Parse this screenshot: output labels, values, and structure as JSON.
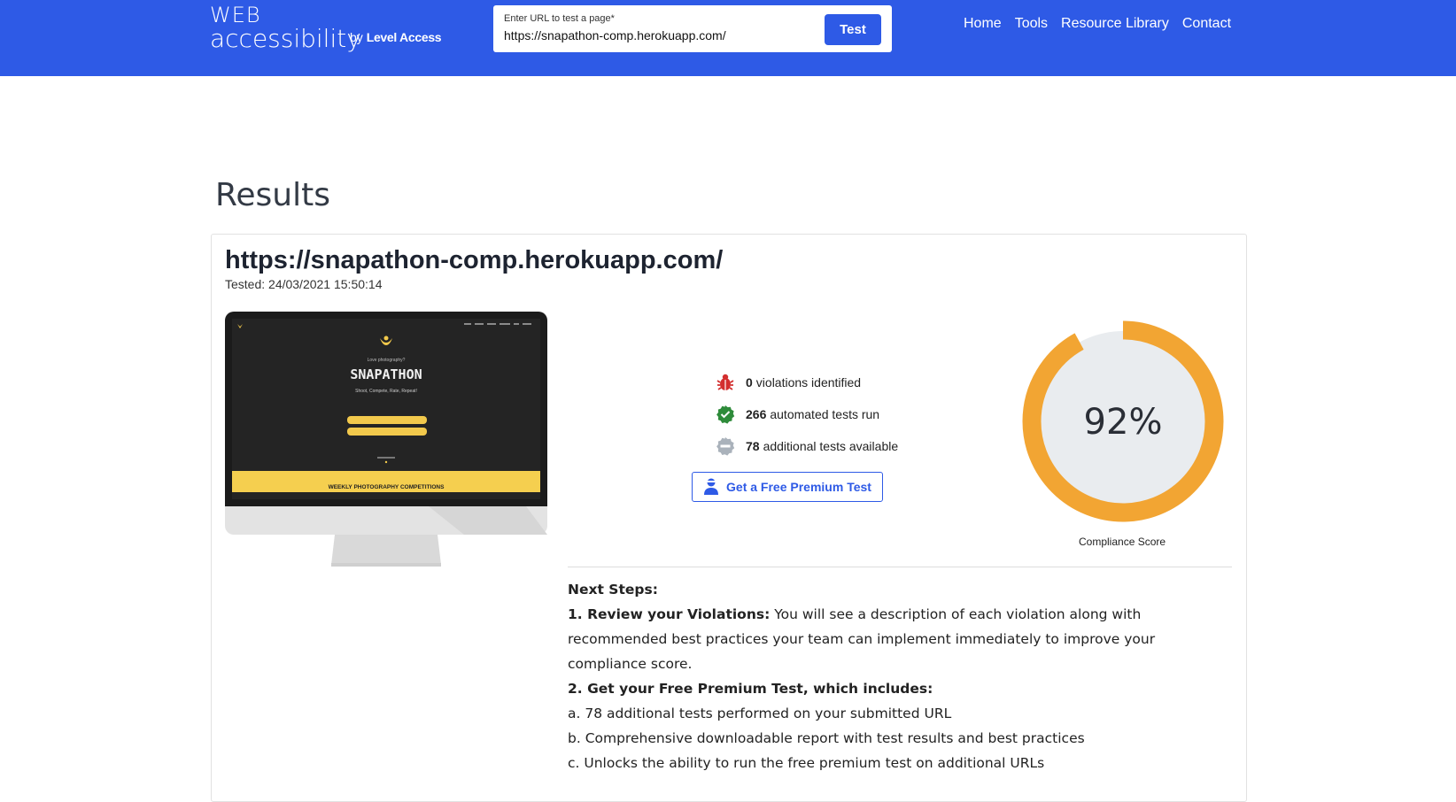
{
  "header": {
    "logo_top": "WEB",
    "logo_main": "accessibility",
    "logo_by": "by",
    "logo_brand": "Level Access",
    "url_label": "Enter URL to test a page*",
    "url_value": "https://snapathon-comp.herokuapp.com/",
    "test_button": "Test",
    "nav": [
      "Home",
      "Tools",
      "Resource Library",
      "Contact"
    ]
  },
  "page_title": "Results",
  "result": {
    "url": "https://snapathon-comp.herokuapp.com/",
    "tested": "Tested: 24/03/2021 15:50:14"
  },
  "preview": {
    "tagline": "Love photography?",
    "brand": "SNAPATHON",
    "sub": "Shoot, Compete, Rate, Repeat!",
    "banner": "WEEKLY PHOTOGRAPHY COMPETITIONS"
  },
  "stats": [
    {
      "icon": "bug-icon",
      "count": "0",
      "text": "violations identified",
      "color": "#d32f2f"
    },
    {
      "icon": "check-badge-icon",
      "count": "266",
      "text": "automated tests run",
      "color": "#2e8b3a"
    },
    {
      "icon": "minus-badge-icon",
      "count": "78",
      "text": "additional tests available",
      "color": "#9aa3ad"
    }
  ],
  "premium_button": "Get a Free Premium Test",
  "score": {
    "value_text": "92%",
    "fraction": 0.92,
    "label": "Compliance Score",
    "ring_color": "#f2a533",
    "track_color": "#e9ecef"
  },
  "next_steps": {
    "heading": "Next Steps:",
    "step1_title": "1. Review your Violations:",
    "step1_text": " You will see a description of each violation along with recommended best practices your team can implement immediately to improve your compliance score.",
    "step2_title": "2. Get your Free Premium Test, which includes:",
    "items": [
      "a. 78 additional tests performed on your submitted URL",
      "b. Comprehensive downloadable report with test results and best practices",
      "c. Unlocks the ability to run the free premium test on additional URLs"
    ]
  }
}
